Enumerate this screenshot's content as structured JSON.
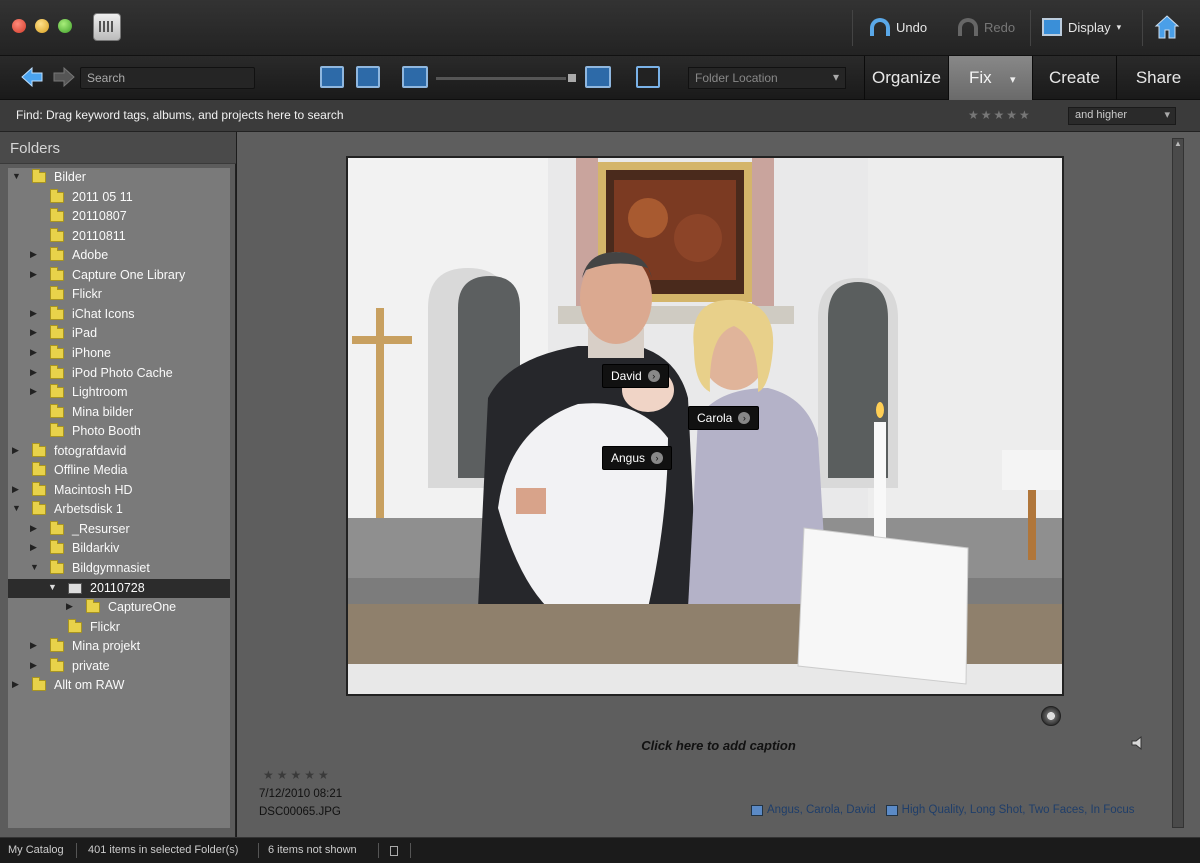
{
  "window": {
    "undo_label": "Undo",
    "redo_label": "Redo",
    "display_label": "Display"
  },
  "toolbar": {
    "search_placeholder": "Search",
    "folder_location_label": "Folder Location",
    "tabs": [
      {
        "label": "Organize",
        "active": false
      },
      {
        "label": "Fix",
        "active": true
      },
      {
        "label": "Create",
        "active": false
      },
      {
        "label": "Share",
        "active": false
      }
    ]
  },
  "findbar": {
    "text": "Find: Drag keyword tags, albums, and projects here to search",
    "stars": "★★★★★",
    "filter_value": "and higher"
  },
  "folders": {
    "title": "Folders",
    "rows": [
      {
        "label": "Bilder",
        "indent": 0,
        "expander": "▼",
        "icon": "folder"
      },
      {
        "label": "2011 05 11",
        "indent": 1,
        "expander": "",
        "icon": "folder"
      },
      {
        "label": "20110807",
        "indent": 1,
        "expander": "",
        "icon": "folder"
      },
      {
        "label": "20110811",
        "indent": 1,
        "expander": "",
        "icon": "folder"
      },
      {
        "label": "Adobe",
        "indent": 1,
        "expander": "▶",
        "icon": "folder"
      },
      {
        "label": "Capture One Library",
        "indent": 1,
        "expander": "▶",
        "icon": "folder"
      },
      {
        "label": "Flickr",
        "indent": 1,
        "expander": "",
        "icon": "folder"
      },
      {
        "label": "iChat Icons",
        "indent": 1,
        "expander": "▶",
        "icon": "folder"
      },
      {
        "label": "iPad",
        "indent": 1,
        "expander": "▶",
        "icon": "folder"
      },
      {
        "label": "iPhone",
        "indent": 1,
        "expander": "▶",
        "icon": "folder"
      },
      {
        "label": "iPod Photo Cache",
        "indent": 1,
        "expander": "▶",
        "icon": "folder"
      },
      {
        "label": "Lightroom",
        "indent": 1,
        "expander": "▶",
        "icon": "folder"
      },
      {
        "label": "Mina bilder",
        "indent": 1,
        "expander": "",
        "icon": "folder"
      },
      {
        "label": "Photo Booth",
        "indent": 1,
        "expander": "",
        "icon": "folder"
      },
      {
        "label": "fotografdavid",
        "indent": 0,
        "expander": "▶",
        "icon": "folder"
      },
      {
        "label": "Offline Media",
        "indent": 0,
        "expander": "",
        "icon": "folder"
      },
      {
        "label": "Macintosh HD",
        "indent": 0,
        "expander": "▶",
        "icon": "folder"
      },
      {
        "label": "Arbetsdisk 1",
        "indent": 0,
        "expander": "▼",
        "icon": "folder"
      },
      {
        "label": "_Resurser",
        "indent": 1,
        "expander": "▶",
        "icon": "folder"
      },
      {
        "label": "Bildarkiv",
        "indent": 1,
        "expander": "▶",
        "icon": "folder"
      },
      {
        "label": "Bildgymnasiet",
        "indent": 1,
        "expander": "▼",
        "icon": "folder"
      },
      {
        "label": "20110728",
        "indent": 2,
        "expander": "▼",
        "icon": "disk",
        "selected": true
      },
      {
        "label": "CaptureOne",
        "indent": 3,
        "expander": "▶",
        "icon": "folder"
      },
      {
        "label": "Flickr",
        "indent": 2,
        "expander": "",
        "icon": "folder"
      },
      {
        "label": "Mina projekt",
        "indent": 1,
        "expander": "▶",
        "icon": "folder"
      },
      {
        "label": "private",
        "indent": 1,
        "expander": "▶",
        "icon": "folder"
      },
      {
        "label": "Allt om RAW",
        "indent": 0,
        "expander": "▶",
        "icon": "folder"
      }
    ]
  },
  "photo": {
    "face_tags": [
      {
        "name": "David"
      },
      {
        "name": "Carola"
      },
      {
        "name": "Angus"
      }
    ],
    "caption_placeholder": "Click here to add caption",
    "rating": "★★★★★",
    "date": "7/12/2010 08:21",
    "filename": "DSC00065.JPG",
    "people": "Angus, Carola, David",
    "keywords": "High Quality, Long Shot, Two Faces, In Focus"
  },
  "status": {
    "catalog": "My Catalog",
    "items_in_folder": "401 items in selected Folder(s)",
    "items_not_shown": "6 items not shown"
  }
}
